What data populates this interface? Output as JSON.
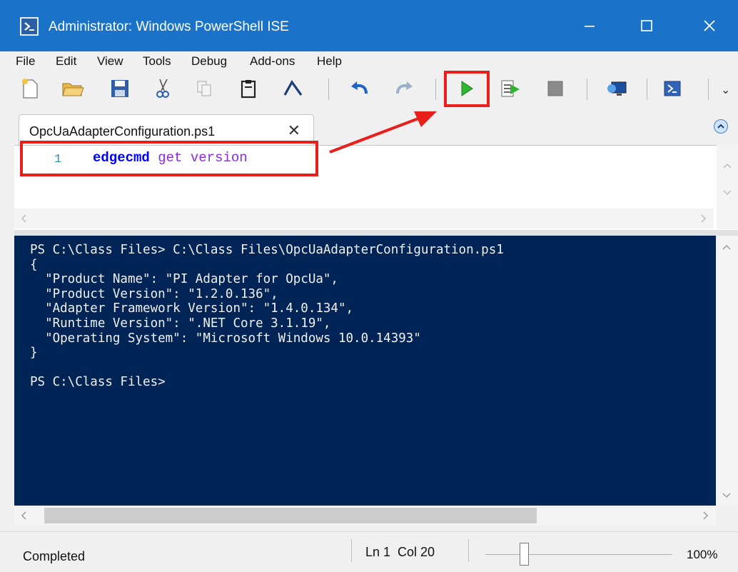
{
  "window": {
    "title": "Administrator: Windows PowerShell ISE",
    "minimize": "—",
    "maximize": "☐",
    "close": "✕"
  },
  "menu": [
    "File",
    "Edit",
    "View",
    "Tools",
    "Debug",
    "Add-ons",
    "Help"
  ],
  "toolbar": {
    "icons": [
      "new-file-icon",
      "open-folder-icon",
      "save-icon",
      "cut-icon",
      "copy-icon",
      "paste-icon",
      "clear-console-icon",
      "undo-icon",
      "redo-icon",
      "run-script-icon",
      "run-selection-icon",
      "stop-icon",
      "new-remote-tab-icon",
      "start-powershell-icon"
    ],
    "overflow": "⌄"
  },
  "tab": {
    "label": "OpcUaAdapterConfiguration.ps1",
    "close": "✕"
  },
  "editor": {
    "line_number": "1",
    "code_command": "edgecmd",
    "code_args": " get version"
  },
  "console": {
    "lines": [
      "PS C:\\Class Files> C:\\Class Files\\OpcUaAdapterConfiguration.ps1",
      "{",
      "  \"Product Name\": \"PI Adapter for OpcUa\",",
      "  \"Product Version\": \"1.2.0.136\",",
      "  \"Adapter Framework Version\": \"1.4.0.134\",",
      "  \"Runtime Version\": \".NET Core 3.1.19\",",
      "  \"Operating System\": \"Microsoft Windows 10.0.14393\"",
      "}",
      "",
      "PS C:\\Class Files>"
    ]
  },
  "status": {
    "text": "Completed",
    "position": "Ln 1  Col 20",
    "zoom": "100%"
  },
  "colors": {
    "titlebar": "#1a73c9",
    "console_bg": "#012456",
    "highlight": "#e8201c"
  }
}
